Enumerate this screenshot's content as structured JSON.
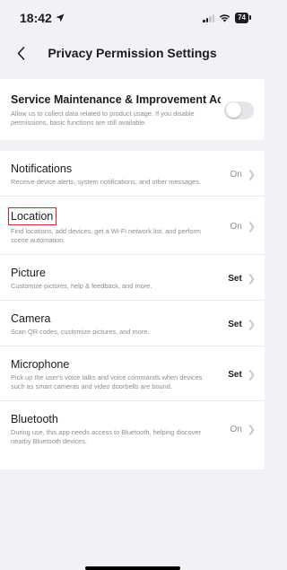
{
  "status_bar": {
    "time": "18:42",
    "location_icon": "location-arrow-icon",
    "battery": "74"
  },
  "nav": {
    "back_icon": "chevron-left-icon",
    "title": "Privacy Permission Settings"
  },
  "service": {
    "title": "Service Maintenance & Improvement Acti...",
    "description": "Allow us to collect data related to product usage. If you disable permissions, basic functions are still available.",
    "toggle_state": "off"
  },
  "permissions": [
    {
      "title": "Notifications",
      "description": "Receive device alerts, system notifications, and other messages.",
      "value": "On"
    },
    {
      "title": "Location",
      "description": "Find locations, add devices, get a Wi-Fi network list, and perform scene automation.",
      "value": "On",
      "highlighted": true
    },
    {
      "title": "Picture",
      "description": "Customize pictures, help & feedback, and more.",
      "value": "Set"
    },
    {
      "title": "Camera",
      "description": "Scan QR codes, customize pictures, and more.",
      "value": "Set"
    },
    {
      "title": "Microphone",
      "description": "Pick up the user's voice talks and voice commands when devices such as smart cameras and video doorbells are bound.",
      "value": "Set"
    },
    {
      "title": "Bluetooth",
      "description": "During use, this app needs access to Bluetooth, helping discover nearby Bluetooth devices.",
      "value": "On"
    }
  ],
  "colors": {
    "background": "#f2f2f6",
    "card": "#ffffff",
    "highlight": "#e0202a",
    "muted": "#8e8e93"
  }
}
